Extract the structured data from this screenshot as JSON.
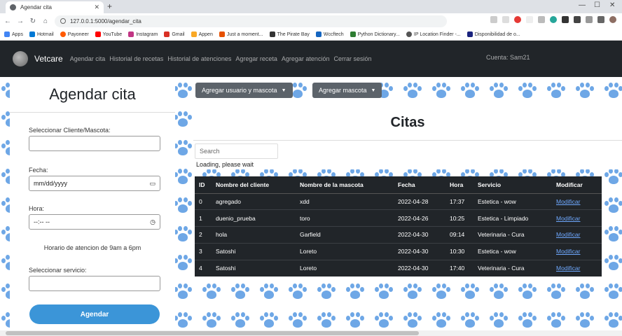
{
  "browser": {
    "tab_title": "Agendar cita",
    "url": "127.0.0.1:5000/agendar_cita",
    "bookmarks": [
      "Apps",
      "Hotmail",
      "Payoneer",
      "YouTube",
      "Instagram",
      "Gmail",
      "Appen",
      "Just a moment...",
      "The Pirate Bay",
      "Wccftech",
      "Python Dictionary...",
      "IP Location Finder -...",
      "Disponibilidad de o..."
    ]
  },
  "nav": {
    "brand": "Vetcare",
    "links": [
      "Agendar cita",
      "Historial de recetas",
      "Historial de atenciones",
      "Agregar receta",
      "Agregar atención",
      "Cerrar sesión"
    ],
    "account": "Cuenta: Sam21"
  },
  "form": {
    "title": "Agendar cita",
    "client_label": "Seleccionar Cliente/Mascota:",
    "client_value": "",
    "date_label": "Fecha:",
    "date_value": "mm/dd/yyyy",
    "time_label": "Hora:",
    "time_value": "--:-- --",
    "hours_note": "Horario de atencion de 9am a 6pm",
    "service_label": "Seleccionar servicio:",
    "service_value": "",
    "submit_label": "Agendar"
  },
  "dropdowns": {
    "user_pet": "Agregar usuario y mascota",
    "pet": "Agregar mascota"
  },
  "citas": {
    "title": "Citas",
    "search_placeholder": "Search",
    "loading": "Loading, please wait",
    "columns": [
      "ID",
      "Nombre del cliente",
      "Nombre de la mascota",
      "Fecha",
      "Hora",
      "Servicio",
      "Modificar"
    ],
    "rows": [
      [
        "0",
        "agregado",
        "xdd",
        "2022-04-28",
        "17:37",
        "Estetica - wow",
        "Modificar"
      ],
      [
        "1",
        "duenio_prueba",
        "toro",
        "2022-04-26",
        "10:25",
        "Estetica - Limpiado",
        "Modificar"
      ],
      [
        "2",
        "hola",
        "Garfield",
        "2022-04-30",
        "09:14",
        "Veterinaria - Cura",
        "Modificar"
      ],
      [
        "3",
        "Satoshi",
        "Loreto",
        "2022-04-30",
        "10:30",
        "Estetica - wow",
        "Modificar"
      ],
      [
        "4",
        "Satoshi",
        "Loreto",
        "2022-04-30",
        "17:40",
        "Veterinaria - Cura",
        "Modificar"
      ]
    ]
  },
  "colors": {
    "navbar": "#212529",
    "paw": "#6ea7e6",
    "submit": "#3b95d8",
    "dropdown": "#5c636a",
    "table": "#212529",
    "link": "#6ea8fe"
  }
}
